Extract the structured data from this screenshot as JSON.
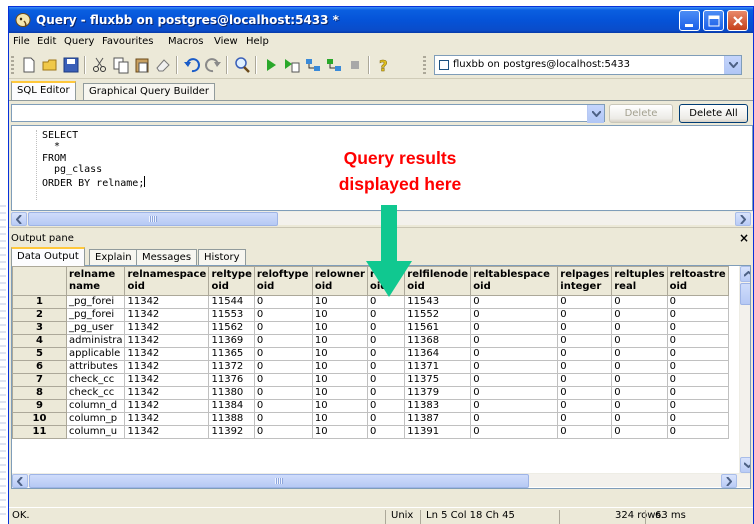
{
  "window": {
    "title": "Query - fluxbb on postgres@localhost:5433 *"
  },
  "menu": [
    "File",
    "Edit",
    "Query",
    "Favourites",
    "Macros",
    "View",
    "Help"
  ],
  "toolbar": {
    "connection": "fluxbb on postgres@localhost:5433"
  },
  "editor_tabs": [
    "SQL Editor",
    "Graphical Query Builder"
  ],
  "sql_buttons": {
    "delete": "Delete",
    "delete_all": "Delete All"
  },
  "sql": {
    "line1": "SELECT",
    "line2": "  *",
    "line3": "FROM",
    "line4": "  pg_class",
    "line5": "ORDER BY relname;"
  },
  "annotation": {
    "line1": "Query results",
    "line2": "displayed here"
  },
  "output": {
    "title": "Output pane",
    "close": "×",
    "tabs": [
      "Data Output",
      "Explain",
      "Messages",
      "History"
    ]
  },
  "grid": {
    "columns": [
      {
        "name": "relname",
        "type": "name"
      },
      {
        "name": "relnamespace",
        "type": "oid"
      },
      {
        "name": "reltype",
        "type": "oid"
      },
      {
        "name": "reloftype",
        "type": "oid"
      },
      {
        "name": "relowner",
        "type": "oid"
      },
      {
        "name": "relam",
        "type": "oid"
      },
      {
        "name": "relfilenode",
        "type": "oid"
      },
      {
        "name": "reltablespace",
        "type": "oid"
      },
      {
        "name": "relpages",
        "type": "integer"
      },
      {
        "name": "reltuples",
        "type": "real"
      },
      {
        "name": "reltoastre",
        "type": "oid"
      }
    ],
    "rows": [
      [
        "1",
        "_pg_forei",
        "11342",
        "11544",
        "0",
        "10",
        "0",
        "11543",
        "0",
        "0",
        "0",
        "0"
      ],
      [
        "2",
        "_pg_forei",
        "11342",
        "11553",
        "0",
        "10",
        "0",
        "11552",
        "0",
        "0",
        "0",
        "0"
      ],
      [
        "3",
        "_pg_user",
        "11342",
        "11562",
        "0",
        "10",
        "0",
        "11561",
        "0",
        "0",
        "0",
        "0"
      ],
      [
        "4",
        "administra",
        "11342",
        "11369",
        "0",
        "10",
        "0",
        "11368",
        "0",
        "0",
        "0",
        "0"
      ],
      [
        "5",
        "applicable",
        "11342",
        "11365",
        "0",
        "10",
        "0",
        "11364",
        "0",
        "0",
        "0",
        "0"
      ],
      [
        "6",
        "attributes",
        "11342",
        "11372",
        "0",
        "10",
        "0",
        "11371",
        "0",
        "0",
        "0",
        "0"
      ],
      [
        "7",
        "check_cc",
        "11342",
        "11376",
        "0",
        "10",
        "0",
        "11375",
        "0",
        "0",
        "0",
        "0"
      ],
      [
        "8",
        "check_cc",
        "11342",
        "11380",
        "0",
        "10",
        "0",
        "11379",
        "0",
        "0",
        "0",
        "0"
      ],
      [
        "9",
        "column_d",
        "11342",
        "11384",
        "0",
        "10",
        "0",
        "11383",
        "0",
        "0",
        "0",
        "0"
      ],
      [
        "10",
        "column_p",
        "11342",
        "11388",
        "0",
        "10",
        "0",
        "11387",
        "0",
        "0",
        "0",
        "0"
      ],
      [
        "11",
        "column_u",
        "11342",
        "11392",
        "0",
        "10",
        "0",
        "11391",
        "0",
        "0",
        "0",
        "0"
      ]
    ]
  },
  "status": {
    "message": "OK.",
    "line_ending": "Unix",
    "position": "Ln 5 Col 18 Ch 45",
    "rows": "324 rows.",
    "time": "63 ms"
  },
  "colors": {
    "annotation": "#ff0000",
    "arrow": "#10c890",
    "titlebar": "#0553d8"
  }
}
